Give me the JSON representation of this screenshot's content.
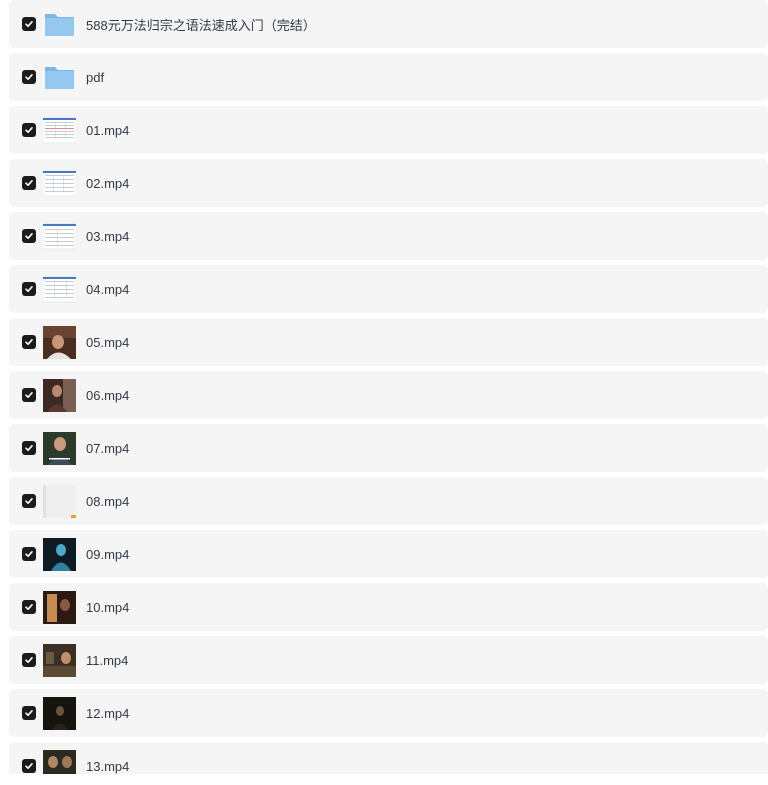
{
  "items": [
    {
      "name": "588元万法归宗之语法速成入门（完结）",
      "kind": "folder",
      "icon": "folder-icon",
      "checked": true
    },
    {
      "name": "pdf",
      "kind": "folder",
      "icon": "folder-icon",
      "checked": true
    },
    {
      "name": "01.mp4",
      "kind": "video",
      "icon": "table-thumbnail",
      "checked": true
    },
    {
      "name": "02.mp4",
      "kind": "video",
      "icon": "table-thumbnail",
      "checked": true
    },
    {
      "name": "03.mp4",
      "kind": "video",
      "icon": "table-thumbnail",
      "checked": true
    },
    {
      "name": "04.mp4",
      "kind": "video",
      "icon": "table-thumbnail",
      "checked": true
    },
    {
      "name": "05.mp4",
      "kind": "video",
      "icon": "scene-thumbnail",
      "checked": true
    },
    {
      "name": "06.mp4",
      "kind": "video",
      "icon": "scene-thumbnail",
      "checked": true
    },
    {
      "name": "07.mp4",
      "kind": "video",
      "icon": "scene-thumbnail",
      "checked": true
    },
    {
      "name": "08.mp4",
      "kind": "video",
      "icon": "blank-thumbnail",
      "checked": true
    },
    {
      "name": "09.mp4",
      "kind": "video",
      "icon": "dark-scene-thumbnail",
      "checked": true
    },
    {
      "name": "10.mp4",
      "kind": "video",
      "icon": "scene-thumbnail",
      "checked": true
    },
    {
      "name": "11.mp4",
      "kind": "video",
      "icon": "scene-thumbnail",
      "checked": true
    },
    {
      "name": "12.mp4",
      "kind": "video",
      "icon": "dark-scene-thumbnail",
      "checked": true
    },
    {
      "name": "13.mp4",
      "kind": "video",
      "icon": "scene-thumbnail",
      "checked": true
    }
  ],
  "colors": {
    "row_bg": "#f5f5f6",
    "checkbox": "#1c1c1e",
    "folder": "#8fc3ee",
    "text": "#333a45"
  }
}
